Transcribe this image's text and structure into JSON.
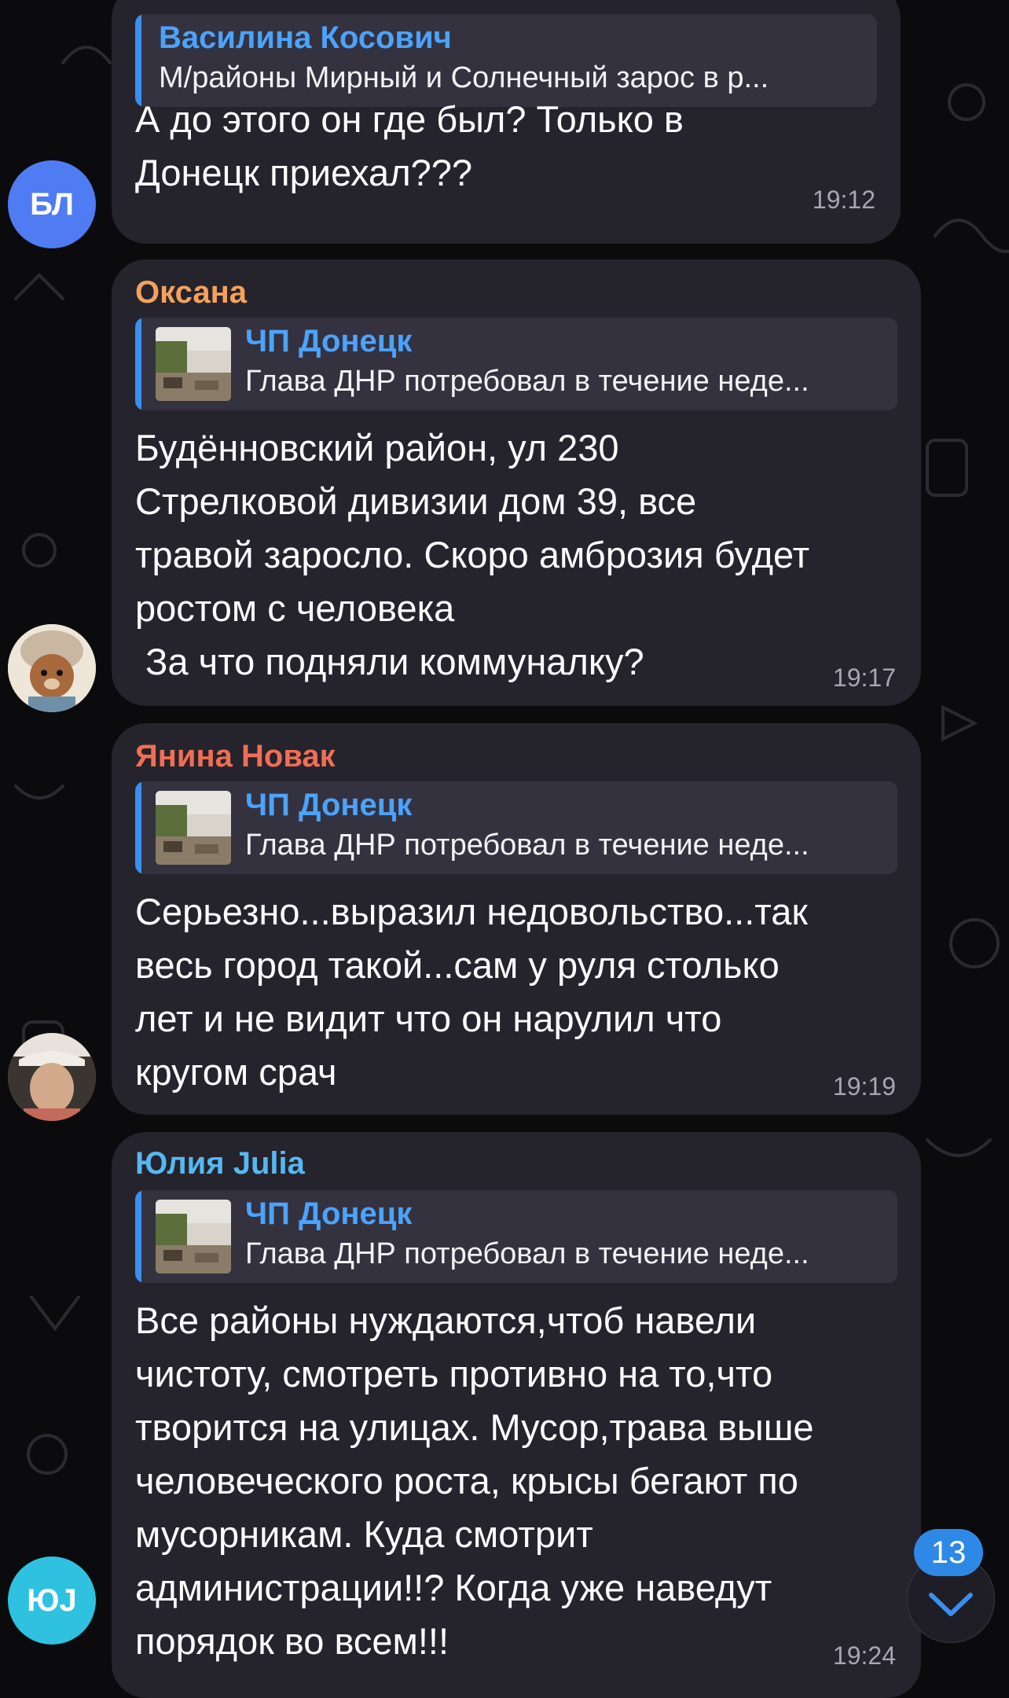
{
  "messages": [
    {
      "avatar_initials": "БЛ",
      "reply": {
        "name": "Василина Косович",
        "text": "М/районы Мирный и Солнечный зарос в р..."
      },
      "body_lines": [
        "А до этого он где был? Только в",
        "Донецк приехал???"
      ],
      "time": "19:12"
    },
    {
      "sender": "Оксана",
      "reply": {
        "name": "ЧП Донецк",
        "text": "Глава ДНР потребовал в течение неде..."
      },
      "body_lines": [
        "Будённовский район, ул 230",
        "Стрелковой дивизии дом 39, все",
        "травой заросло. Скоро амброзия будет",
        "ростом с человека",
        " За что подняли коммуналку?"
      ],
      "time": "19:17"
    },
    {
      "sender": "Янина Новак",
      "reply": {
        "name": "ЧП Донецк",
        "text": "Глава ДНР потребовал в течение неде..."
      },
      "body_lines": [
        "Серьезно...выразил недовольство...так",
        "весь город такой...сам у руля столько",
        "лет и не видит что он нарулил что",
        "кругом срач"
      ],
      "time": "19:19"
    },
    {
      "sender": "Юлия Julia",
      "avatar_initials": "ЮJ",
      "reply": {
        "name": "ЧП Донецк",
        "text": "Глава ДНР потребовал в течение неде..."
      },
      "body_lines": [
        "Все районы нуждаются,чтоб навели",
        "чистоту, смотреть противно на то,что",
        "творится на улицах. Мусор,трава выше",
        "человеческого роста, крысы бегают по",
        "мусорникам. Куда смотрит",
        "администрации!!? Когда уже наведут",
        "порядок во всем!!!"
      ],
      "time": "19:24"
    }
  ],
  "unread_count": "13",
  "colors": {
    "sender_oksana": "#f5a15c",
    "sender_yanina": "#f06e55",
    "sender_julia": "#56b8f0",
    "reply_name": "#4ba3ff",
    "avatar_bl": "#4f7cf3",
    "avatar_yuj": "#2fc1e0",
    "badge": "#2e88e6"
  },
  "icons": [
    "chevron-down-icon"
  ]
}
